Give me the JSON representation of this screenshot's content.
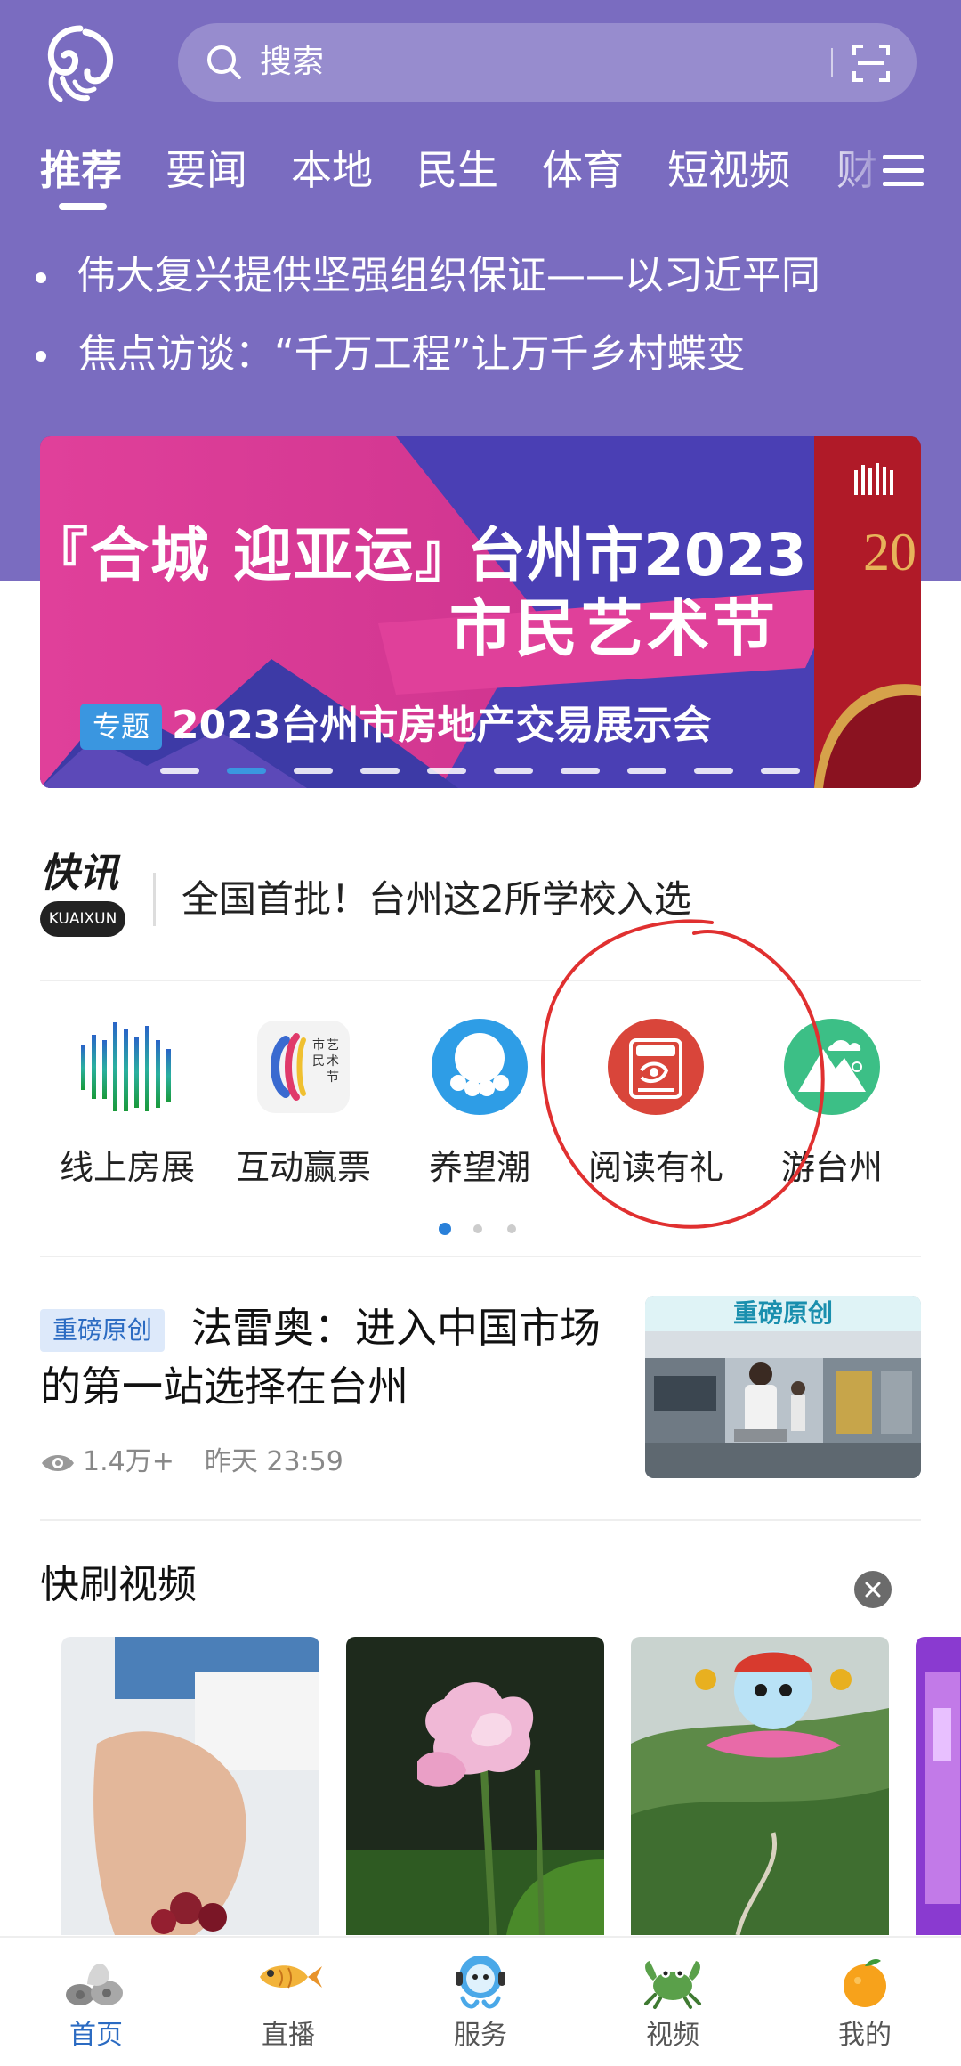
{
  "colors": {
    "header_bg": "#7a6cc0",
    "accent_blue": "#2b6bc2",
    "annotation_red": "#e03030"
  },
  "search": {
    "placeholder": "搜索",
    "search_icon": "search-icon",
    "scan_icon": "scan-icon"
  },
  "tabs": [
    {
      "label": "推荐",
      "active": true
    },
    {
      "label": "要闻"
    },
    {
      "label": "本地"
    },
    {
      "label": "民生"
    },
    {
      "label": "体育"
    },
    {
      "label": "短视频"
    },
    {
      "label": "财"
    }
  ],
  "headlines": [
    "为实现中华民族伟大复兴提供坚强组织保证——以习近平同",
    "焦点访谈：“千万工程”让万千乡村蝶变"
  ],
  "banner": {
    "line1": "『合城 迎亚运』",
    "line2": "台州市2023",
    "line3": "市民艺术节",
    "badge": "专题",
    "title": "2023台州市房地产交易展示会",
    "slide_count": 10,
    "active_slide": 1
  },
  "kuaixun": {
    "logo_title": "快讯",
    "logo_sub": "KUAIXUN",
    "text": "全国首批！台州这2所学校入选"
  },
  "services": [
    {
      "label": "线上房展",
      "icon": "sound-bars-icon"
    },
    {
      "label": "互动赢票",
      "icon": "art-festival-icon"
    },
    {
      "label": "养望潮",
      "icon": "octopus-icon"
    },
    {
      "label": "阅读有礼",
      "icon": "reading-gift-icon",
      "circled": true
    },
    {
      "label": "游台州",
      "icon": "mountain-hiker-icon"
    }
  ],
  "services_pager": {
    "pages": 3,
    "active": 0
  },
  "article": {
    "badge": "重磅原创",
    "title": "法雷奥：进入中国市场的第一站选择在台州",
    "views": "1.4万+",
    "time": "昨天 23:59",
    "thumb_label": "重磅原创"
  },
  "video_section": {
    "title": "快刷视频",
    "close_icon": "close-icon"
  },
  "bottom_nav": [
    {
      "label": "首页",
      "icon": "home-shells-icon",
      "active": true
    },
    {
      "label": "直播",
      "icon": "fish-icon"
    },
    {
      "label": "服务",
      "icon": "octopus-headset-icon"
    },
    {
      "label": "视频",
      "icon": "crab-icon"
    },
    {
      "label": "我的",
      "icon": "orange-icon"
    }
  ]
}
